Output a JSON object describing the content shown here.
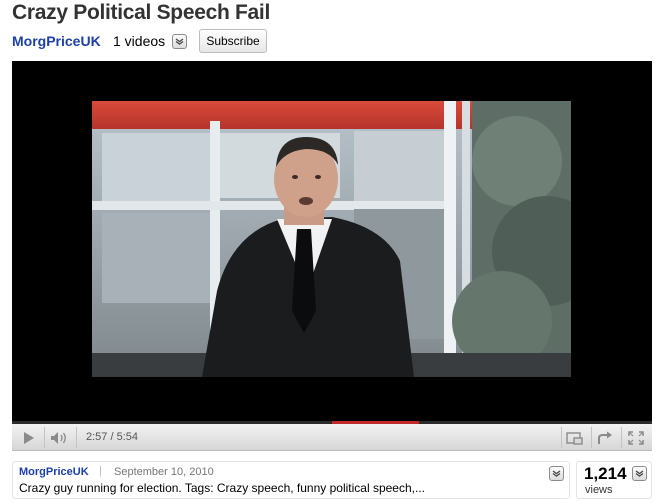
{
  "video": {
    "title": "Crazy Political Speech Fail"
  },
  "channel": {
    "name": "MorgPriceUK",
    "video_count": "1 videos",
    "subscribe_label": "Subscribe"
  },
  "player": {
    "time_display": "2:57 / 5:54",
    "progress_fraction": 0.5,
    "icons": [
      "play-icon",
      "volume-icon",
      "popout-icon",
      "share-icon",
      "fullscreen-icon"
    ]
  },
  "info": {
    "uploader": "MorgPriceUK",
    "separator": "|",
    "date": "September 10, 2010",
    "description": "Crazy guy running for election. Tags: Crazy speech, funny political speech,..."
  },
  "stats": {
    "views_count": "1,214",
    "views_label": "views"
  },
  "colors": {
    "link": "#1c3fa8",
    "progress_played": "#c22a2a"
  }
}
